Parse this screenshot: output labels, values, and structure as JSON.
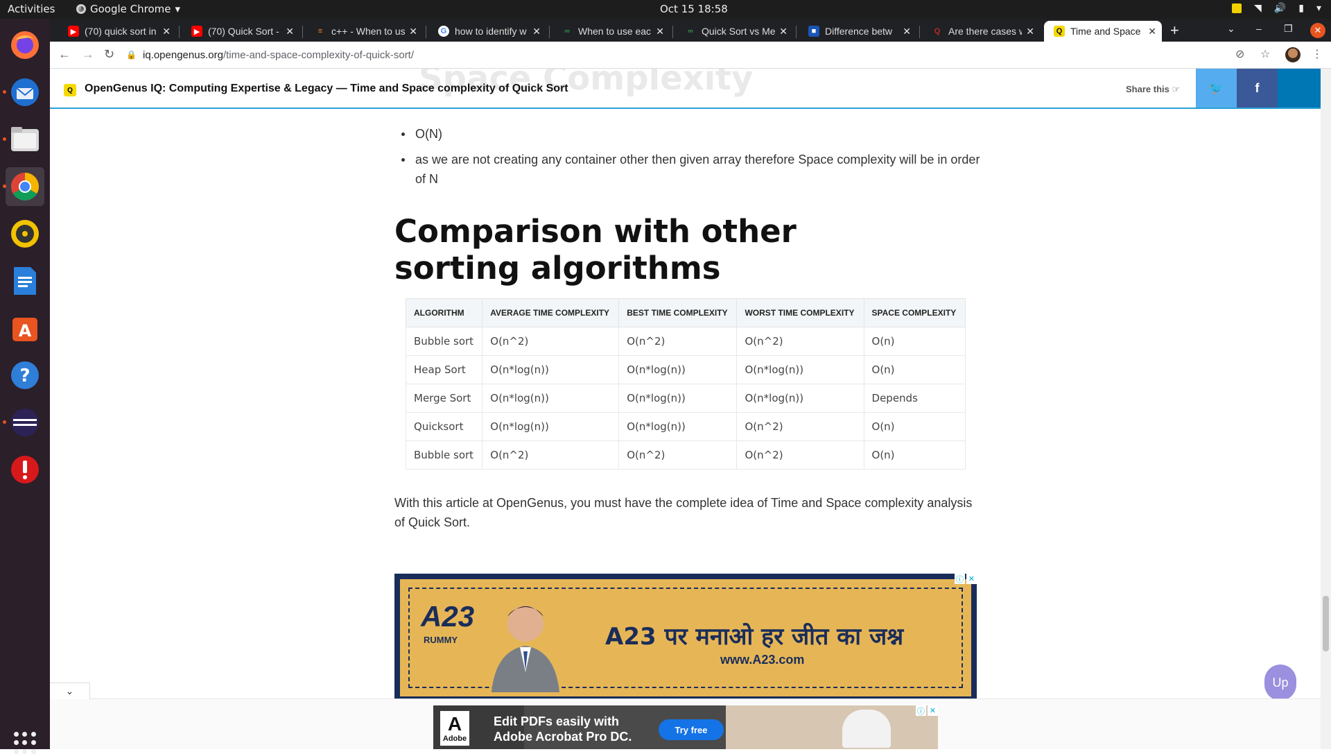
{
  "topbar": {
    "activities": "Activities",
    "app_name": "Google Chrome",
    "clock": "Oct 15  18:58"
  },
  "dock": {
    "apps": [
      "firefox-icon",
      "thunderbird-icon",
      "files-icon",
      "chrome-icon",
      "rhythmbox-icon",
      "writer-icon",
      "software-icon",
      "help-icon",
      "eclipse-icon",
      "updates-icon"
    ]
  },
  "tabs": [
    {
      "title": "(70) quick sort in",
      "favicon": "youtube-icon"
    },
    {
      "title": "(70) Quick Sort -",
      "favicon": "youtube-icon"
    },
    {
      "title": "c++ - When to use",
      "favicon": "stackoverflow-icon"
    },
    {
      "title": "how to identify w",
      "favicon": "google-icon"
    },
    {
      "title": "When to use eac",
      "favicon": "gfg-icon"
    },
    {
      "title": "Quick Sort vs Me",
      "favicon": "gfg-icon"
    },
    {
      "title": "Difference betw",
      "favicon": "site-icon"
    },
    {
      "title": "Are there cases w",
      "favicon": "quora-icon"
    },
    {
      "title": "Time and Space c",
      "favicon": "opengenus-icon",
      "active": true
    }
  ],
  "address_bar": {
    "host": "iq.opengenus.org",
    "path": "/time-and-space-complexity-of-quick-sort/"
  },
  "site": {
    "title": "OpenGenus IQ: Computing Expertise & Legacy",
    "separator": " — ",
    "article_title": "Time and Space complexity of Quick Sort",
    "ghost_heading": "Space Complexity",
    "share_label": "Share this"
  },
  "article": {
    "bullets": [
      "O(N)",
      "as we are not creating any container other then given array therefore Space complexity will be in order of N"
    ],
    "heading": "Comparison with other sorting algorithms",
    "table": {
      "headers": [
        "ALGORITHM",
        "AVERAGE TIME COMPLEXITY",
        "BEST TIME COMPLEXITY",
        "WORST TIME COMPLEXITY",
        "SPACE COMPLEXITY"
      ],
      "rows": [
        [
          "Bubble sort",
          "O(n^2)",
          "O(n^2)",
          "O(n^2)",
          "O(n)"
        ],
        [
          "Heap Sort",
          "O(n*log(n))",
          "O(n*log(n))",
          "O(n*log(n))",
          "O(n)"
        ],
        [
          "Merge Sort",
          "O(n*log(n))",
          "O(n*log(n))",
          "O(n*log(n))",
          "Depends"
        ],
        [
          "Quicksort",
          "O(n*log(n))",
          "O(n*log(n))",
          "O(n^2)",
          "O(n)"
        ],
        [
          "Bubble sort",
          "O(n^2)",
          "O(n^2)",
          "O(n^2)",
          "O(n)"
        ]
      ]
    },
    "conclusion": "With this article at OpenGenus, you must have the complete idea of Time and Space complexity analysis of Quick Sort."
  },
  "ads": {
    "a23": {
      "brand": "A23",
      "brand_sub": "RUMMY",
      "headline": "A23 पर मनाओ हर जीत का जश्न",
      "site": "www.A23.com"
    },
    "adobe": {
      "logo_text": "Adobe",
      "headline_line1": "Edit PDFs easily with",
      "headline_line2": "Adobe Acrobat Pro DC.",
      "cta": "Try free"
    }
  },
  "up_button": "Up",
  "colors": {
    "accent": "#2a9fd6",
    "twitter": "#55acee",
    "facebook": "#3b5998",
    "linkedin": "#0077b5",
    "ubuntu_orange": "#e95420"
  }
}
